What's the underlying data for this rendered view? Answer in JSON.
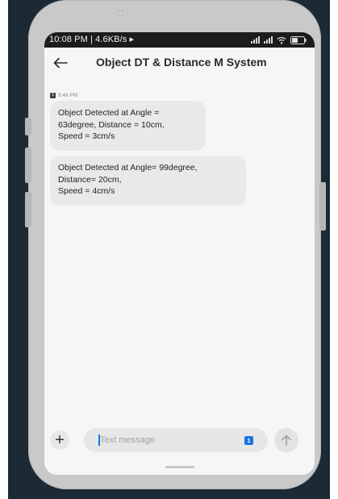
{
  "status_bar": {
    "text": "10:08 PM | 4.6KB/s ▸",
    "battery": "47"
  },
  "header": {
    "title": "Object DT & Distance M System"
  },
  "conversation": {
    "sim_label": "1",
    "timestamp": "9:49 PM",
    "messages": [
      {
        "text": "Object Detected at Angle =\n63degree, Distance = 10cm,\nSpeed = 3cm/s"
      },
      {
        "text": "Object Detected at Angle= 99degree,\nDistance= 20cm,\nSpeed = 4cm/s"
      }
    ]
  },
  "composer": {
    "placeholder": "Text message",
    "sim_label": "1",
    "add_symbol": "+"
  },
  "colors": {
    "accent": "#1a73e8",
    "bubble": "#e9e9e9",
    "status_bar": "#1c1c1c"
  }
}
